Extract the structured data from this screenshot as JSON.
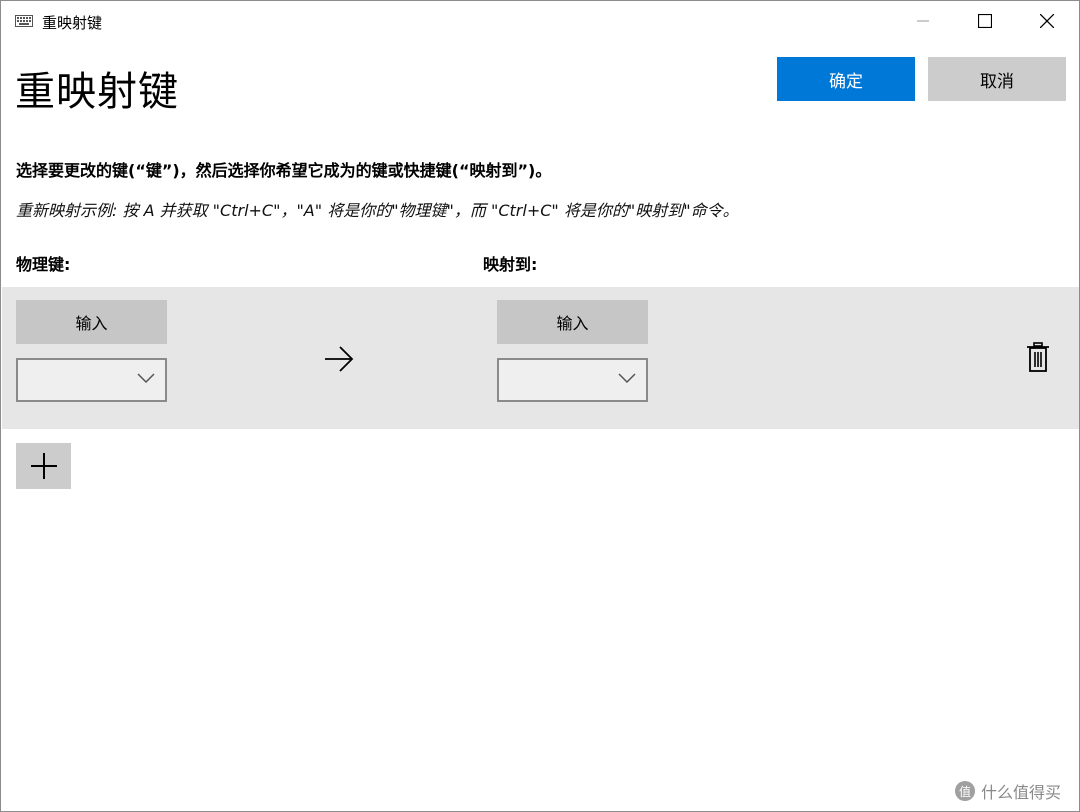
{
  "window": {
    "title": "重映射键",
    "controls": {
      "minimize": "minimize-icon",
      "maximize": "maximize-icon",
      "close": "close-icon"
    }
  },
  "header": {
    "title": "重映射键",
    "ok_label": "确定",
    "cancel_label": "取消"
  },
  "instructions": {
    "main": "选择要更改的键(“键”)，然后选择你希望它成为的键或快捷键(“映射到”)。",
    "example": "重新映射示例: 按 A 并获取 \"Ctrl+C\"，\"A\" 将是你的\"物理键\"，而 \"Ctrl+C\" 将是你的\"映射到\"命令。"
  },
  "columns": {
    "physical": "物理键:",
    "mapped": "映射到:"
  },
  "row": {
    "physical_type_label": "输入",
    "physical_value": "",
    "mapped_type_label": "输入",
    "mapped_value": ""
  },
  "watermark": {
    "badge": "值",
    "text": "什么值得买"
  },
  "colors": {
    "accent": "#0078d7",
    "row_band": "#e6e6e6"
  }
}
